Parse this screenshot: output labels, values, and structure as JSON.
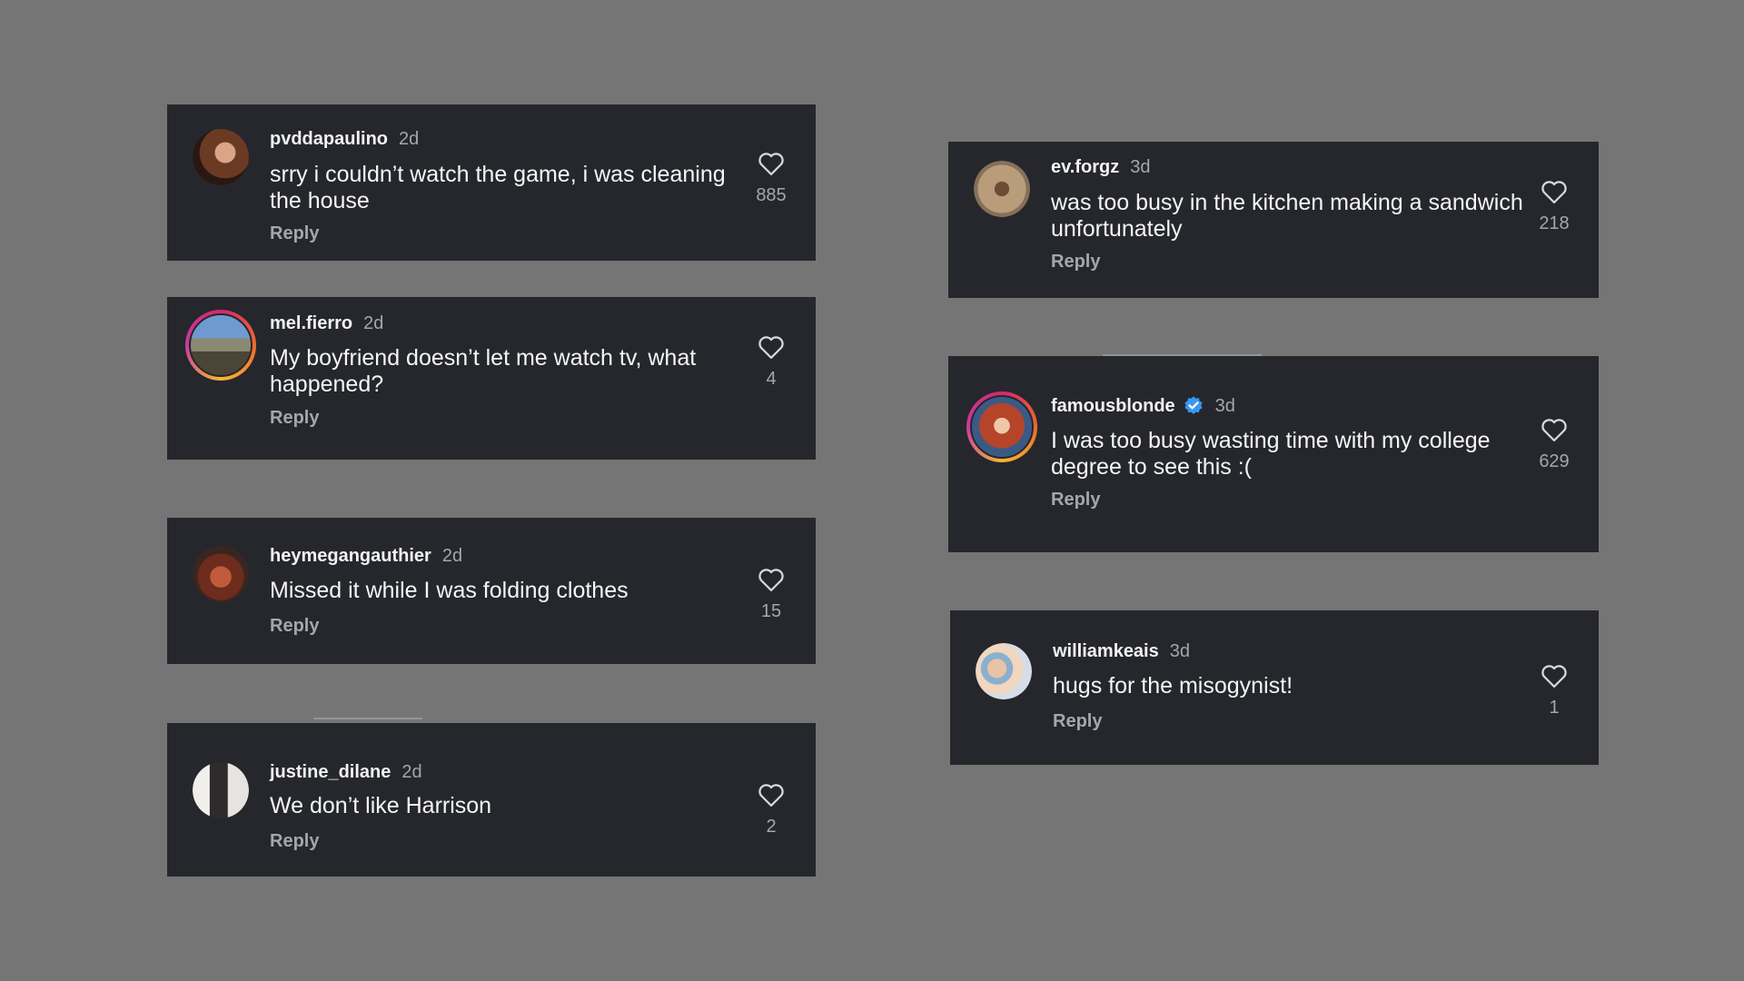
{
  "comments": [
    {
      "username": "pvddapaulino",
      "time": "2d",
      "text": "srry i couldn’t watch the game, i was cleaning the house",
      "reply_label": "Reply",
      "likes": "885",
      "story_ring": false
    },
    {
      "username": "mel.fierro",
      "time": "2d",
      "text": "My boyfriend doesn’t let me watch tv, what happened?",
      "reply_label": "Reply",
      "likes": "4",
      "story_ring": true
    },
    {
      "username": "heymegangauthier",
      "time": "2d",
      "text": "Missed it while I was folding clothes",
      "reply_label": "Reply",
      "likes": "15",
      "story_ring": false
    },
    {
      "username": "justine_dilane",
      "time": "2d",
      "text": "We don’t like Harrison",
      "reply_label": "Reply",
      "likes": "2",
      "story_ring": false
    },
    {
      "username": "ev.forgz",
      "time": "3d",
      "text": "was too busy in the kitchen making a sandwich unfortunately",
      "reply_label": "Reply",
      "likes": "218",
      "story_ring": false
    },
    {
      "username": "famousblonde",
      "time": "3d",
      "verified": true,
      "text": "I was too busy wasting time with my college degree to see this :(",
      "reply_label": "Reply",
      "likes": "629",
      "story_ring": true
    },
    {
      "username": "williamkeais",
      "time": "3d",
      "text": "hugs for the misogynist!",
      "reply_label": "Reply",
      "likes": "1",
      "story_ring": false
    }
  ],
  "icons": {
    "like": "heart-outline-icon",
    "verified": "verified-badge-icon"
  },
  "colors": {
    "background": "#757575",
    "card": "#25272c",
    "primary_text": "#f5f5f5",
    "secondary_text": "#a4a7ad",
    "verified_blue": "#3897f0",
    "story_ring": "#d4286f"
  }
}
